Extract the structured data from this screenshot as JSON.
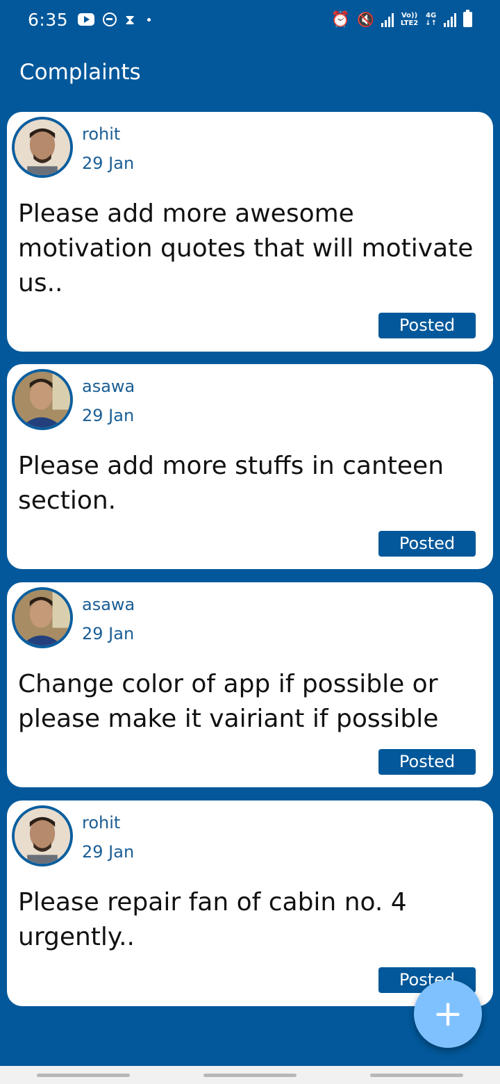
{
  "status_bar": {
    "time": "6:35",
    "left_icons": [
      "youtube-icon",
      "dnd-icon",
      "hourglass-icon",
      "dot-icon"
    ],
    "right_icons": [
      "alarm-icon",
      "mute-icon",
      "signal-icon",
      "volte-icon",
      "4g-icon",
      "signal-icon",
      "battery-icon"
    ],
    "volte_top": "Vo))",
    "volte_bottom": "LTE2",
    "net_top": "4G",
    "net_bottom": "↓↑"
  },
  "app_bar": {
    "title": "Complaints"
  },
  "complaints": [
    {
      "author": "rohit",
      "date": "29 Jan",
      "message": "Please add more awesome motivation quotes that will motivate us..",
      "status": "Posted"
    },
    {
      "author": "asawa",
      "date": "29 Jan",
      "message": "Please add more stuffs in canteen section.",
      "status": "Posted"
    },
    {
      "author": "asawa",
      "date": "29 Jan",
      "message": "Change color of app if possible or please make it vairiant if possible",
      "status": "Posted"
    },
    {
      "author": "rohit",
      "date": "29 Jan",
      "message": "Please repair fan of cabin no. 4 urgently..",
      "status": "Posted"
    }
  ],
  "fab": {
    "icon": "plus-icon",
    "glyph": "+"
  },
  "colors": {
    "background": "#02589a",
    "card": "#ffffff",
    "accent_text": "#1b5e95",
    "badge": "#02589a",
    "fab": "#7fc1ff"
  }
}
